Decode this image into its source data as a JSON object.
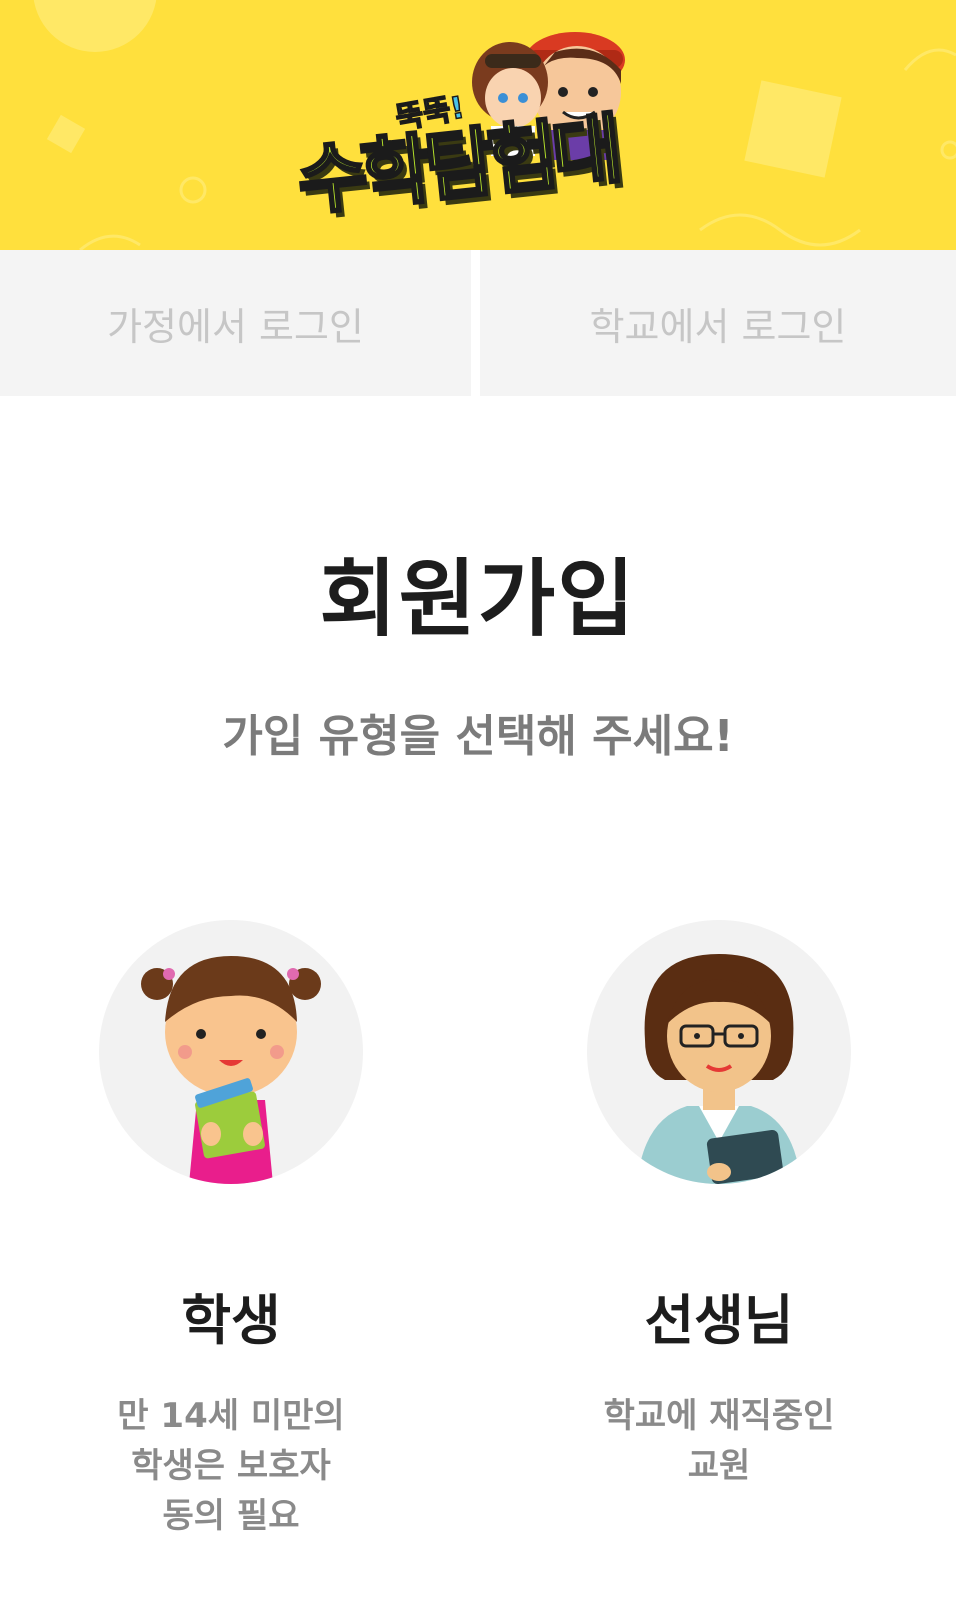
{
  "header": {
    "logo_sub": "뚝뚝!",
    "logo_title": "수학탐험대",
    "background_color": "#ffe03d"
  },
  "tabs": {
    "home_login": "가정에서 로그인",
    "school_login": "학교에서 로그인"
  },
  "main": {
    "title": "회원가입",
    "subtitle": "가입 유형을 선택해 주세요!"
  },
  "member_types": [
    {
      "label": "학생",
      "icon": "student-girl-illustration",
      "description": [
        "만 14세 미만의",
        "학생은 보호자",
        "동의 필요"
      ]
    },
    {
      "label": "선생님",
      "icon": "teacher-illustration",
      "description": [
        "학교에 재직중인",
        "교원"
      ]
    }
  ]
}
